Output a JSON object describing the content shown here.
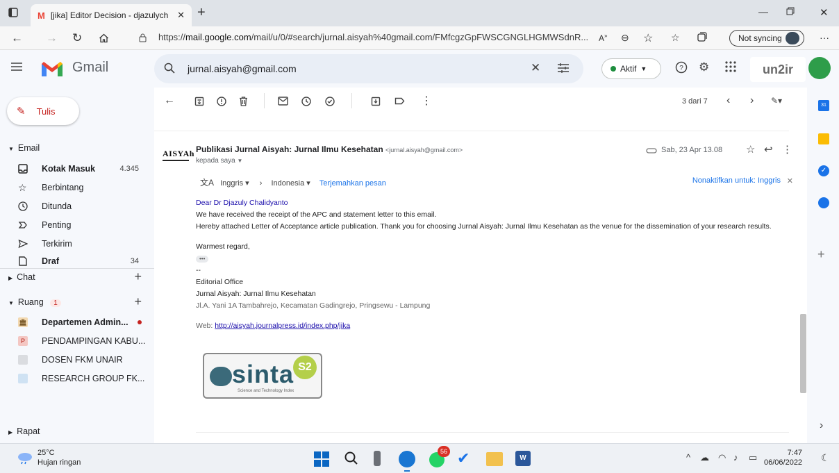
{
  "browser": {
    "tab_title": "[jika] Editor Decision - djazulych",
    "url_prefix": "https://",
    "url_domain": "mail.google.com",
    "url_rest": "/mail/u/0/#search/jurnal.aisyah%40gmail.com/FMfcgzGpFWSCGNGLHGMWSdnR...",
    "sync_label": "Not syncing"
  },
  "gmail": {
    "brand": "Gmail",
    "search_value": "jurnal.aisyah@gmail.com",
    "status_label": "Aktif",
    "account_logo_text": "un2ir"
  },
  "sidebar": {
    "compose_label": "Tulis",
    "email_section": "Email",
    "items": [
      {
        "label": "Kotak Masuk",
        "count": "4.345"
      },
      {
        "label": "Berbintang",
        "count": ""
      },
      {
        "label": "Ditunda",
        "count": ""
      },
      {
        "label": "Penting",
        "count": ""
      },
      {
        "label": "Terkirim",
        "count": ""
      },
      {
        "label": "Draf",
        "count": "34"
      }
    ],
    "chat_section": "Chat",
    "ruang_section": "Ruang",
    "ruang_badge": "1",
    "spaces": [
      {
        "label": "Departemen Admin...",
        "initial": "",
        "color": "#f3d9b1"
      },
      {
        "label": "PENDAMPINGAN KABU...",
        "initial": "P",
        "color": "#f4c7c3"
      },
      {
        "label": "DOSEN FKM UNAIR",
        "initial": "",
        "color": "#dadce0"
      },
      {
        "label": "RESEARCH GROUP FK...",
        "initial": "",
        "color": "#cfe2f3"
      }
    ],
    "rapat_section": "Rapat"
  },
  "toolbar": {
    "pager": "3 dari 7"
  },
  "message": {
    "sender_logo": "AISYAh",
    "sender_name": "Publikasi Jurnal Aisyah: Jurnal Ilmu Kesehatan",
    "sender_email": "<jurnal.aisyah@gmail.com>",
    "to_line": "kepada saya",
    "date": "Sab, 23 Apr 13.08",
    "translate": {
      "from": "Inggris",
      "to": "Indonesia",
      "action": "Terjemahkan pesan",
      "disable": "Nonaktifkan untuk: Inggris"
    },
    "greeting": "Dear Dr Djazuly Chalidyanto",
    "line1": "We have received the receipt of the APC and statement letter to this email.",
    "line2": "Hereby attached Letter of Acceptance article publication. Thank you for choosing Jurnal Aisyah: Jurnal Ilmu Kesehatan as the venue for the dissemination of your research results.",
    "closing": "Warmest regard,",
    "ellipsis": "•••",
    "sig_dash": "--",
    "sig_office": "Editorial Office",
    "sig_journal": "Jurnal Aisyah: Jurnal Ilmu Kesehatan",
    "sig_address": "Jl.A. Yani 1A Tambahrejo, Kecamatan Gadingrejo, Pringsewu - Lampung",
    "web_label": "Web: ",
    "web_url": "http://aisyah.journalpress.id/index.php/jika",
    "sinta_text": "sinta",
    "sinta_badge": "S2",
    "sinta_sub": "Science and Technology Index"
  },
  "taskbar": {
    "temp": "25°C",
    "weather": "Hujan ringan",
    "notif_badge": "56",
    "time": "7:47",
    "date": "06/06/2022"
  }
}
